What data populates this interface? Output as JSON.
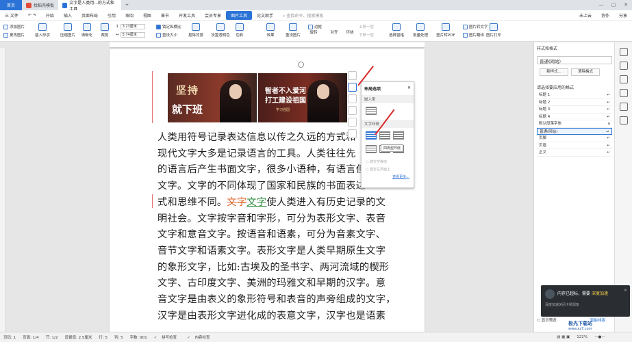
{
  "tabs": {
    "home": "首页",
    "template": "找稻壳模板",
    "doc": "文字是人类用...的方式和工具",
    "add": "+"
  },
  "menu": {
    "file": "三 文件",
    "items": [
      "开始",
      "插入",
      "页面布局",
      "引用",
      "审阅",
      "视图",
      "章节",
      "开发工具",
      "会员专享"
    ],
    "picture_tool": "图片工具",
    "essay": "论文助手",
    "search": "查找命令、搜索模板",
    "cloud": "未上云",
    "collab": "协作",
    "share": "分享"
  },
  "ribbon": {
    "add_picture": "添加图片",
    "change_picture": "更改图片",
    "insert_shape": "插入形状",
    "compress": "压缩图片",
    "clarify": "清晰化",
    "crop": "裁剪",
    "height_val": "3.23厘米",
    "width_val": "5.74厘米",
    "lock_ratio": "锁定纵横比",
    "reset_size": "重设大小",
    "cutout": "抠除背景",
    "set_transparent": "设置透明色",
    "color": "色彩",
    "effects": "效果",
    "reset_picture": "重设图片",
    "border": "边框",
    "rotate": "旋转",
    "align": "对齐",
    "wrap": "环绕",
    "move_up": "上移一层",
    "move_down": "下移一层",
    "select_pane": "选择窗格",
    "batch": "批量处理",
    "to_pdf": "图片转PDF",
    "to_text": "图片转文字",
    "translate": "图片翻译",
    "print": "图片打印"
  },
  "images": {
    "left_text1": "坚持",
    "left_text2": "就下班",
    "right_text1": "智者不入爱河",
    "right_text2": "打工建设祖国",
    "right_text3": "学习强国"
  },
  "body": {
    "lines": [
      "人类用符号记录表达信息以传之久远的方式和",
      "现代文字大多是记录语言的工具。人类往往先",
      "的语言后产生书面文字，很多小语种，有语言但",
      "文字。文字的不同体现了国家和民族的书面表达",
      "式和思维不同。",
      "明社会。文字按字音和字形，可分为表形文字、表音",
      "文字和意音文字。按语音和语素，可分为音素文字、",
      "音节文字和语素文字。表形文字是人类早期原生文字",
      "的象形文字，比如:古埃及的圣书字、两河流域的楔形",
      "文字、古印度文字、美洲的玛雅文和早期的汉字。意",
      "音文字是由表义的象形符号和表音的声旁组成的文字，",
      "汉字是由表形文字进化成的表意文字，汉字也是语素"
    ],
    "line5_orange": "文字",
    "line5_green": "文字",
    "line5_rest": "使人类进入有历史记录的文"
  },
  "layout_panel": {
    "title": "布局选项",
    "inline": "嵌入型",
    "wrap": "文字环绕",
    "tooltip": "四周型环绕",
    "move_with_text": "随文字移动",
    "fix_on_page": "固定在页面上",
    "see_more": "查看更多..."
  },
  "right_panel": {
    "title": "样式和格式",
    "current": "普通(网站)",
    "new_style": "新样式...",
    "clear_format": "清除格式",
    "apply_label": "请选择要应用的格式",
    "styles": [
      "标题 1",
      "标题 2",
      "标题 3",
      "标题 4",
      "默认段落字体",
      "普通(网站)",
      "页脚",
      "页眉",
      "正文"
    ],
    "show_preview": "显示预览",
    "smart_layout": "智能排版"
  },
  "notification": {
    "title": "内存已超标，需要",
    "action": "深度加速",
    "sub": "深度加速关闭卡顿现象"
  },
  "status": {
    "page": "页码: 1",
    "pages": "页面: 1/4",
    "section": "节: 1/2",
    "setting": "设置值: 2.5厘米",
    "row": "行: 5",
    "col": "列: 5",
    "words": "字数: 901",
    "spell": "拼写检查",
    "content_check": "内容检查",
    "zoom": "122%"
  },
  "watermark": {
    "text": "极光下载站",
    "url": "www.xz7.com"
  }
}
